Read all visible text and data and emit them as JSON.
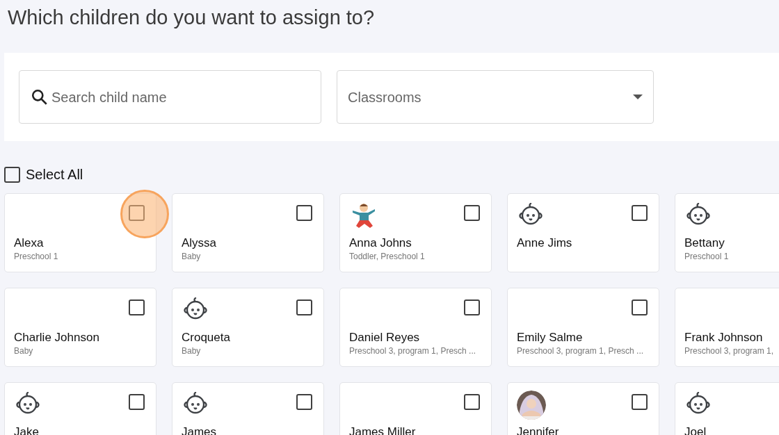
{
  "title": "Which children do you want to assign to?",
  "search": {
    "placeholder": "Search child name"
  },
  "classrooms": {
    "placeholder": "Classrooms"
  },
  "select_all": {
    "label": "Select All",
    "checked": false
  },
  "children": [
    {
      "name": "Alexa",
      "groups": "Preschool 1",
      "kind": "plain",
      "checked": false,
      "focused": true
    },
    {
      "name": "Alyssa",
      "groups": "Baby",
      "kind": "plain",
      "checked": false,
      "focused": false
    },
    {
      "name": "Anna Johns",
      "groups": "Toddler, Preschool 1",
      "kind": "illustration",
      "checked": false,
      "focused": false
    },
    {
      "name": "Anne Jims",
      "kind": "baby",
      "checked": false,
      "focused": false
    },
    {
      "name": "Bettany",
      "groups": "Preschool 1",
      "kind": "baby"
    },
    {
      "name": "Charlie Johnson",
      "groups": "Baby",
      "kind": "plain",
      "checked": false,
      "focused": false
    },
    {
      "name": "Croqueta",
      "groups": "Baby",
      "kind": "baby",
      "checked": false,
      "focused": false
    },
    {
      "name": "Daniel Reyes",
      "groups": "Preschool 3, program 1, Presch ...",
      "kind": "plain",
      "checked": false,
      "focused": false
    },
    {
      "name": "Emily Salme",
      "groups": "Preschool 3, program 1, Presch ...",
      "kind": "plain",
      "checked": false,
      "focused": false
    },
    {
      "name": "Frank Johnson",
      "groups": "Preschool 3, program 1,",
      "kind": "plain"
    },
    {
      "name": "Jake",
      "kind": "baby",
      "checked": false,
      "focused": false
    },
    {
      "name": "James",
      "kind": "baby",
      "checked": false,
      "focused": false
    },
    {
      "name": "James Miller",
      "kind": "plain",
      "checked": false,
      "focused": false
    },
    {
      "name": "Jennifer",
      "checked": false,
      "focused": false
    },
    {
      "name": "Joel",
      "kind": "baby"
    }
  ]
}
